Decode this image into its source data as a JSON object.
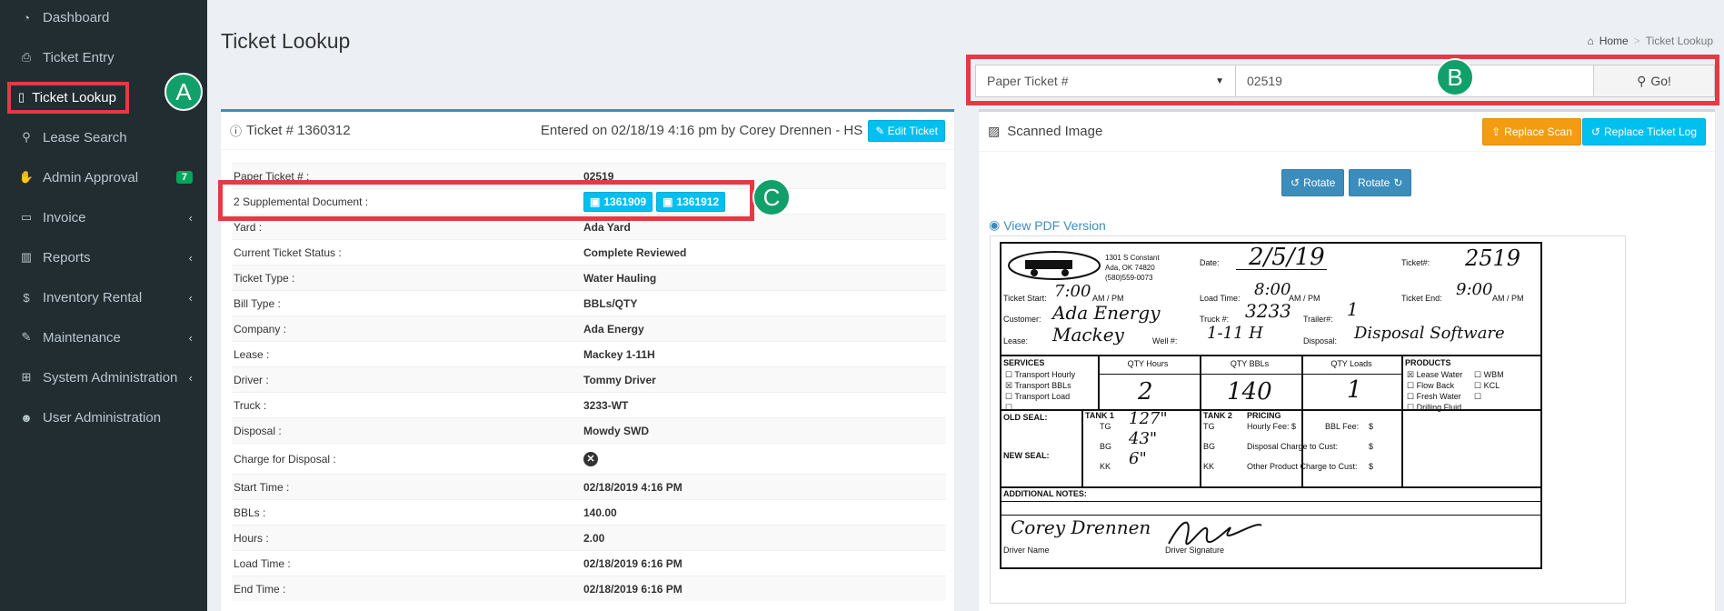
{
  "sidebar": {
    "items": [
      {
        "label": "Dashboard",
        "icon": "dashboard-icon",
        "glyph": "◔"
      },
      {
        "label": "Ticket Entry",
        "icon": "print-icon",
        "glyph": "⎙"
      },
      {
        "label": "Ticket Lookup",
        "icon": "file-icon",
        "glyph": "▯"
      },
      {
        "label": "Lease Search",
        "icon": "search-icon",
        "glyph": "⚲"
      },
      {
        "label": "Admin Approval",
        "icon": "thumbs-up-icon",
        "glyph": "✋",
        "badge": "7"
      },
      {
        "label": "Invoice",
        "icon": "credit-card-icon",
        "glyph": "▭"
      },
      {
        "label": "Reports",
        "icon": "bar-chart-icon",
        "glyph": "▥"
      },
      {
        "label": "Inventory Rental",
        "icon": "dollar-icon",
        "glyph": "$"
      },
      {
        "label": "Maintenance",
        "icon": "wrench-icon",
        "glyph": "✎"
      },
      {
        "label": "System Administration",
        "icon": "sitemap-icon",
        "glyph": "⊞"
      },
      {
        "label": "User Administration",
        "icon": "users-icon",
        "glyph": "☻"
      }
    ],
    "chevron": "‹"
  },
  "callouts": {
    "a": "A",
    "b": "B",
    "c": "C"
  },
  "page": {
    "title": "Ticket Lookup"
  },
  "breadcrumb": {
    "home": "Home",
    "current": "Ticket Lookup"
  },
  "search": {
    "select_value": "Paper Ticket #",
    "input_value": "02519",
    "go_label": "Go!"
  },
  "ticket": {
    "header": "Ticket # 1360312",
    "entered": "Entered on 02/18/19 4:16 pm by Corey Drennen - HS",
    "edit_label": "Edit Ticket",
    "rows": [
      {
        "key": "Paper Ticket # :",
        "value": "02519"
      },
      {
        "key": "2 Supplemental Document :",
        "docs": [
          "1361909",
          "1361912"
        ]
      },
      {
        "key": "Yard :",
        "value": "Ada Yard"
      },
      {
        "key": "Current Ticket Status :",
        "value": "Complete Reviewed"
      },
      {
        "key": "Ticket Type :",
        "value": "Water Hauling"
      },
      {
        "key": "Bill Type :",
        "value": "BBLs/QTY"
      },
      {
        "key": "Company :",
        "value": "Ada Energy"
      },
      {
        "key": "Lease :",
        "value": "Mackey 1-11H"
      },
      {
        "key": "Driver :",
        "value": "Tommy Driver"
      },
      {
        "key": "Truck :",
        "value": "3233-WT"
      },
      {
        "key": "Disposal :",
        "value": "Mowdy SWD"
      },
      {
        "key": "Charge for Disposal :",
        "icon": "x-circle-icon"
      },
      {
        "key": "Start Time :",
        "value": "02/18/2019 4:16 PM"
      },
      {
        "key": "BBLs :",
        "value": "140.00"
      },
      {
        "key": "Hours :",
        "value": "2.00"
      },
      {
        "key": "Load Time :",
        "value": "02/18/2019 6:16 PM"
      },
      {
        "key": "End Time :",
        "value": "02/18/2019 6:16 PM"
      }
    ]
  },
  "scanned": {
    "title": "Scanned Image",
    "replace_scan": "Replace Scan",
    "replace_log": "Replace Ticket Log",
    "rotate_left": "Rotate",
    "rotate_right": "Rotate",
    "pdf_link": "View PDF Version"
  },
  "form": {
    "address": [
      "1301 S Constant",
      "Ada, OK 74820",
      "(580)559-0073"
    ],
    "date_label": "Date:",
    "date_value": "2/5/19",
    "ticketno_label": "Ticket#:",
    "ticketno_value": "2519",
    "start_label": "Ticket Start:",
    "start_value": "7:00",
    "start_ampm": "AM / PM",
    "load_label": "Load Time:",
    "load_value": "8:00",
    "load_ampm": "AM / PM",
    "end_label": "Ticket End:",
    "end_value": "9:00",
    "end_ampm": "AM / PM",
    "customer_label": "Customer:",
    "customer_value": "Ada Energy",
    "truck_label": "Truck #:",
    "truck_value": "3233",
    "trailer_label": "Trailer#:",
    "trailer_value": "1",
    "lease_label": "Lease:",
    "lease_value": "Mackey",
    "well_label": "Well #:",
    "well_value": "1-11 H",
    "disposal_label": "Disposal:",
    "disposal_value": "Disposal Software",
    "services_label": "SERVICES",
    "services": [
      "Transport Hourly",
      "Transport BBLs",
      "Transport Load",
      ""
    ],
    "qty_hours_label": "QTY Hours",
    "qty_hours_value": "2",
    "qty_bbls_label": "QTY BBLs",
    "qty_bbls_value": "140",
    "qty_loads_label": "QTY Loads",
    "qty_loads_value": "1",
    "products_label": "PRODUCTS",
    "products": [
      "Lease Water",
      "Flow Back",
      "Fresh Water",
      "Drilling Fluid"
    ],
    "products2": [
      "WBM",
      "KCL",
      ""
    ],
    "old_seal": "OLD SEAL:",
    "new_seal": "NEW SEAL:",
    "tank1_label": "TANK 1",
    "tank2_label": "TANK 2",
    "tank_rows": [
      "TG",
      "BG",
      "KK"
    ],
    "tank1_values": [
      "127\"",
      "43\"",
      "6\""
    ],
    "pricing_label": "PRICING",
    "hourly_fee": "Hourly Fee: $",
    "bbl_fee": "BBL Fee:",
    "disposal_charge": "Disposal Charge to Cust:",
    "other_charge": "Other Product Charge to Cust:",
    "dollar": "$",
    "notes_label": "ADDITIONAL NOTES:",
    "driver_name_value": "Corey Drennen",
    "driver_name_label": "Driver Name",
    "driver_sig_label": "Driver Signature"
  }
}
